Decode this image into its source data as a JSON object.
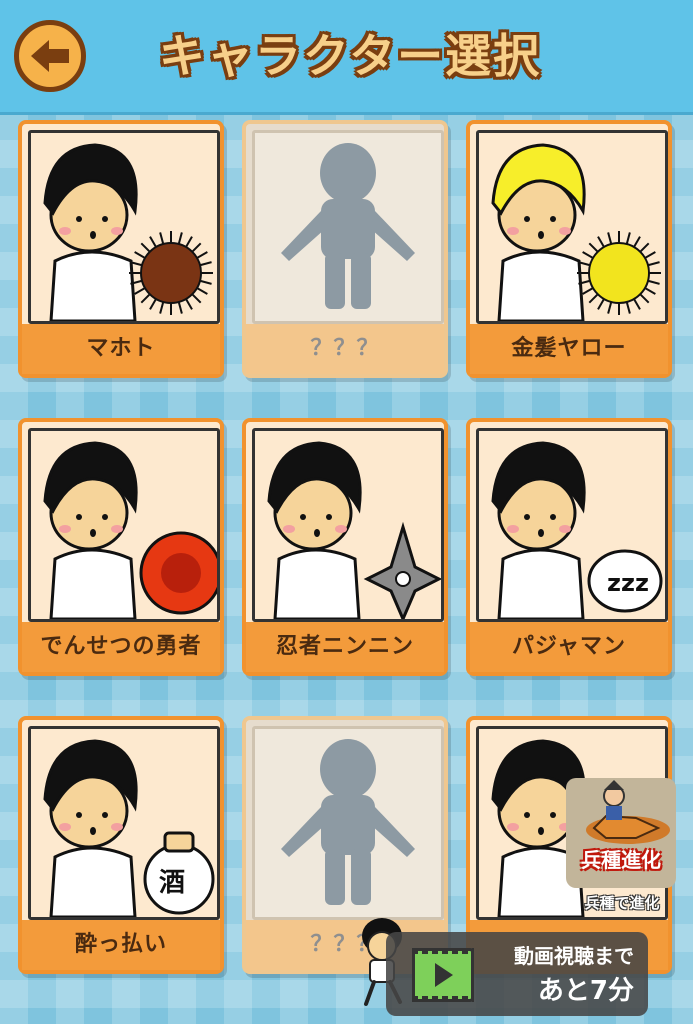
{
  "header": {
    "title": "キャラクター選択"
  },
  "characters": [
    {
      "name": "マホト",
      "locked": false,
      "hair": "#111111",
      "item": "urchin",
      "item_color": "#7a3414"
    },
    {
      "name": "？？？",
      "locked": true
    },
    {
      "name": "金髪ヤロー",
      "locked": false,
      "hair": "#f7ee2a",
      "item": "urchin",
      "item_color": "#f2e41e"
    },
    {
      "name": "でんせつの勇者",
      "locked": false,
      "hair": "#111111",
      "item": "fireball",
      "item_color": "#e63812"
    },
    {
      "name": "忍者ニンニン",
      "locked": false,
      "hair": "#111111",
      "item": "shuriken",
      "item_color": "#8a8a8a"
    },
    {
      "name": "パジャマン",
      "locked": false,
      "hair": "#111111",
      "item": "sleep",
      "item_color": "#ffffff"
    },
    {
      "name": "酔っ払い",
      "locked": false,
      "hair": "#111111",
      "item": "sake",
      "item_color": "#ffffff"
    },
    {
      "name": "？？？",
      "locked": true
    },
    {
      "name": "",
      "locked": false,
      "hair": "#111111",
      "item": "none"
    }
  ],
  "ad": {
    "label": "兵種進化",
    "sub": "兵種で進化"
  },
  "video_banner": {
    "line1": "動画視聴まで",
    "line2": "あと7分"
  },
  "colors": {
    "accent": "#f39b3b",
    "header": "#5fc3e8",
    "outline": "#7a3e10"
  },
  "icons": {
    "back": "left-arrow-icon",
    "play": "film-play-icon"
  }
}
